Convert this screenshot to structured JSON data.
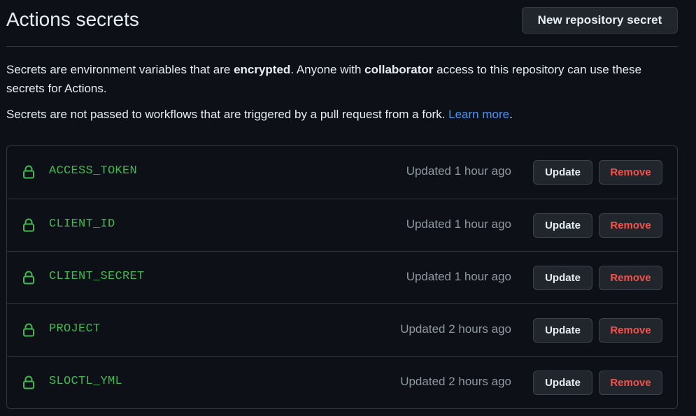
{
  "header": {
    "title": "Actions secrets",
    "new_secret_label": "New repository secret"
  },
  "description": {
    "p1_a": "Secrets are environment variables that are ",
    "p1_b": "encrypted",
    "p1_c": ". Anyone with ",
    "p1_d": "collaborator",
    "p1_e": " access to this repository can use these secrets for Actions.",
    "p2_a": "Secrets are not passed to workflows that are triggered by a pull request from a fork. ",
    "p2_link": "Learn more",
    "p2_end": "."
  },
  "secrets": [
    {
      "name": "ACCESS_TOKEN",
      "updated": "Updated 1 hour ago",
      "update_label": "Update",
      "remove_label": "Remove",
      "icon": "lock-icon"
    },
    {
      "name": "CLIENT_ID",
      "updated": "Updated 1 hour ago",
      "update_label": "Update",
      "remove_label": "Remove",
      "icon": "lock-icon"
    },
    {
      "name": "CLIENT_SECRET",
      "updated": "Updated 1 hour ago",
      "update_label": "Update",
      "remove_label": "Remove",
      "icon": "lock-icon"
    },
    {
      "name": "PROJECT",
      "updated": "Updated 2 hours ago",
      "update_label": "Update",
      "remove_label": "Remove",
      "icon": "lock-icon"
    },
    {
      "name": "SLOCTL_YML",
      "updated": "Updated 2 hours ago",
      "update_label": "Update",
      "remove_label": "Remove",
      "icon": "lock-icon"
    }
  ],
  "colors": {
    "background": "#0d1117",
    "secret_name": "#3fb950",
    "remove_text": "#f85149",
    "link": "#4493f8",
    "border": "#30363d"
  }
}
